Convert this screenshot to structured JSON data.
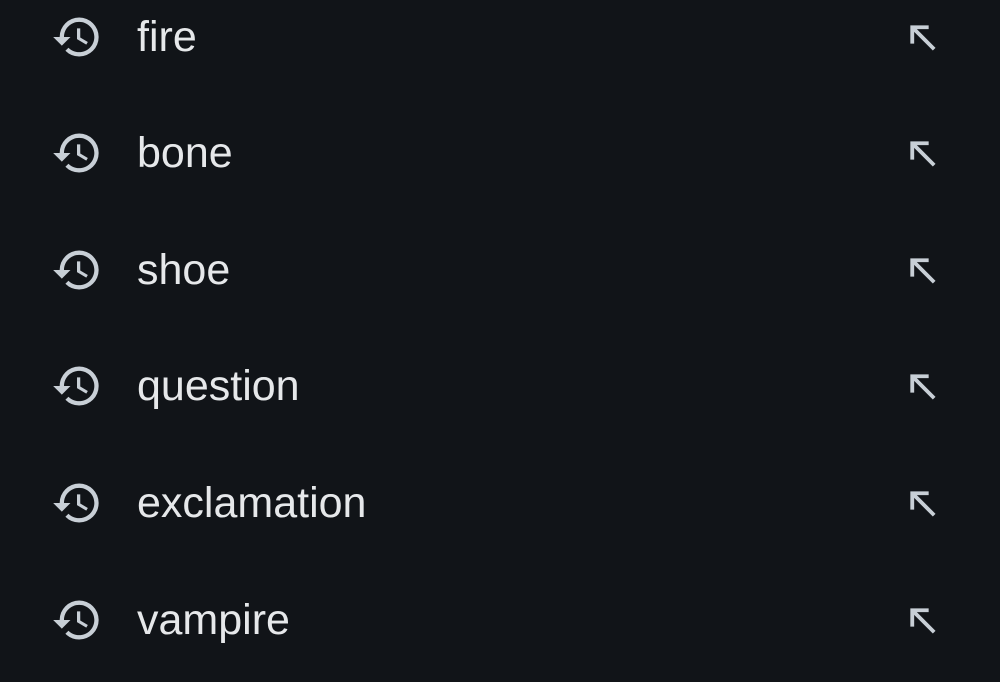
{
  "icon_color": "#c8cfd6",
  "text_color": "#e6e8ea",
  "background_color": "#111418",
  "history_icon_name": "history-icon",
  "fill_icon_name": "arrow-up-left-icon",
  "items": [
    {
      "label": "fire"
    },
    {
      "label": "bone"
    },
    {
      "label": "shoe"
    },
    {
      "label": "question"
    },
    {
      "label": "exclamation"
    },
    {
      "label": "vampire"
    }
  ]
}
